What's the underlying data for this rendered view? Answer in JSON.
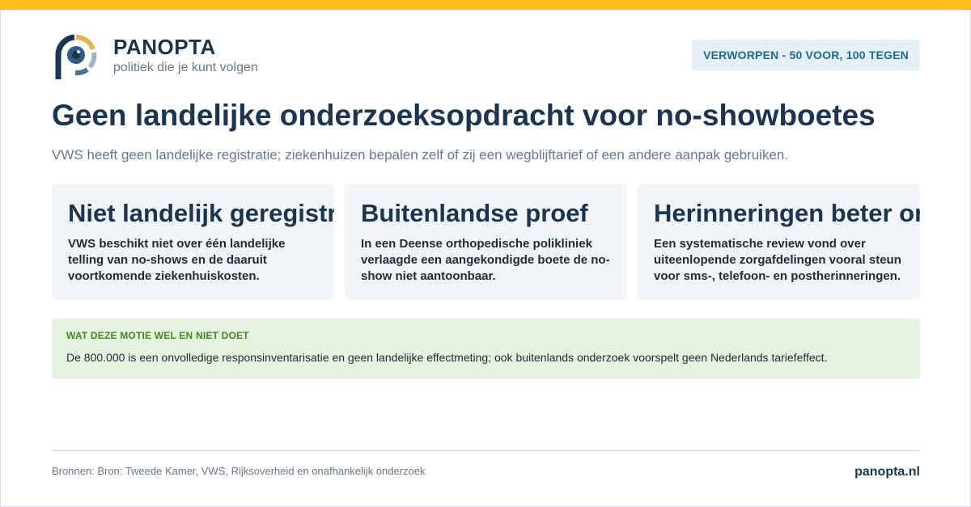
{
  "brand": {
    "name": "PANOPTA",
    "tagline": "politiek die je kunt volgen",
    "domain": "panopta.nl"
  },
  "status": "VERWORPEN - 50 VOOR, 100 TEGEN",
  "title": "Geen landelijke onderzoeksopdracht voor no-showboetes",
  "subtitle": "VWS heeft geen landelijke registratie; ziekenhuizen bepalen zelf of zij een wegblijftarief of een andere aanpak gebruiken.",
  "cards": [
    {
      "heading": "Niet landelijk geregistreerd",
      "body": "VWS beschikt niet over één landelijke telling van no-shows en de daaruit voortkomende ziekenhuiskosten."
    },
    {
      "heading": "Buitenlandse proef",
      "body": "In een Deense orthopedische polikliniek verlaagde een aangekondigde boete de no-show niet aantoonbaar."
    },
    {
      "heading": "Herinneringen beter onderzocht",
      "body": "Een systematische review vond over uiteenlopende zorgafdelingen vooral steun voor sms-, telefoon- en postherinneringen."
    }
  ],
  "note": {
    "title": "WAT DEZE MOTIE WEL EN NIET DOET",
    "text": "De 800.000 is een onvolledige responsinventarisatie en geen landelijke effectmeting; ook buitenlands onderzoek voorspelt geen Nederlands tariefeffect."
  },
  "footer": {
    "sources": "Bronnen: Bron: Tweede Kamer, VWS, Rijksoverheid en onafhankelijk onderzoek"
  },
  "colors": {
    "accent": "#fbbd1c",
    "navy": "#1b3550",
    "badge_bg": "#e4eff6",
    "badge_text": "#1e6b8f",
    "note_bg": "#e6f1df",
    "note_title": "#3f8a1f"
  },
  "icons": {
    "logo": "eye-p-logo-icon"
  }
}
